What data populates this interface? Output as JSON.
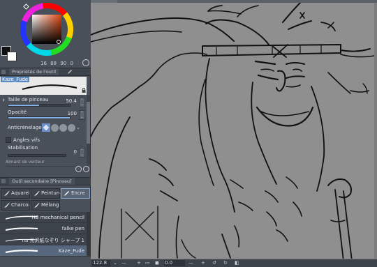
{
  "color": {
    "values": [
      "16",
      "88",
      "90",
      "0"
    ]
  },
  "tool_property": {
    "header_title": "Propriétés de l'outil",
    "brush_name": "Kaze_Fude",
    "brush_size_label": "Taille de pinceau",
    "brush_size_value": "50.4",
    "opacity_label": "Opacité",
    "opacity_value": "100",
    "antialias_label": "Anticrénelage",
    "sharp_angles_label": "Angles vifs",
    "stabilization_label": "Stabilisation",
    "stabilization_value": "0",
    "vector_magnet_label": "Aimant de vecteur"
  },
  "sub_tool": {
    "header_title": "Outil secondaire [Pinceau]",
    "tabs": [
      "Aquarelle",
      "Peinture",
      "Encre",
      "Charcoal",
      "Mélange"
    ],
    "active_tab": "Encre",
    "brushes": [
      {
        "name": "HB mechanical pencil"
      },
      {
        "name": "falke pen"
      },
      {
        "name": "na 光沢紙なぞり シャープ 1"
      },
      {
        "name": "Kaze_Fude"
      }
    ],
    "active_brush": "Kaze_Fude"
  },
  "canvas": {
    "zoom": "122.8",
    "rotation": "0.0"
  },
  "colors": {
    "panel_bg": "#4a5059",
    "canvas_bg": "#8f8f8f",
    "accent": "#8aa6cf",
    "fill_bar": "#8ab0e0"
  }
}
